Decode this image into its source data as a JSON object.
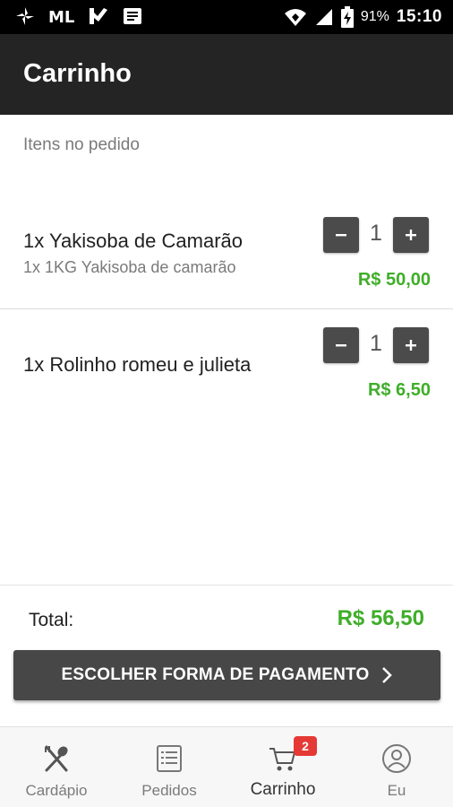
{
  "status_bar": {
    "icons": [
      "pinwheel-icon",
      "ml-logo-icon",
      "check-flag-icon",
      "message-icon"
    ],
    "right_icons": [
      "wifi-icon",
      "signal-icon",
      "battery-charging-icon"
    ],
    "battery": "91%",
    "time": "15:10"
  },
  "app_bar": {
    "title": "Carrinho"
  },
  "order": {
    "section_label": "Itens no pedido",
    "items": [
      {
        "name": "1x Yakisoba de Camarão",
        "detail": "1x 1KG Yakisoba de camarão",
        "quantity": "1",
        "price": "R$ 50,00"
      },
      {
        "name": "1x Rolinho romeu e julieta",
        "detail": "",
        "quantity": "1",
        "price": "R$ 6,50"
      }
    ]
  },
  "summary": {
    "total_label": "Total:",
    "total_value": "R$ 56,50"
  },
  "pay_button": {
    "label": "ESCOLHER FORMA DE PAGAMENTO"
  },
  "bottom_nav": {
    "items": [
      {
        "label": "Cardápio",
        "icon": "fork-spoon-icon",
        "active": false
      },
      {
        "label": "Pedidos",
        "icon": "list-icon",
        "active": false
      },
      {
        "label": "Carrinho",
        "icon": "cart-icon",
        "active": true,
        "badge": "2"
      },
      {
        "label": "Eu",
        "icon": "profile-icon",
        "active": false
      }
    ]
  },
  "colors": {
    "accent_green": "#3fae29",
    "app_bar": "#242424",
    "badge": "#e53935",
    "button": "#474747"
  }
}
